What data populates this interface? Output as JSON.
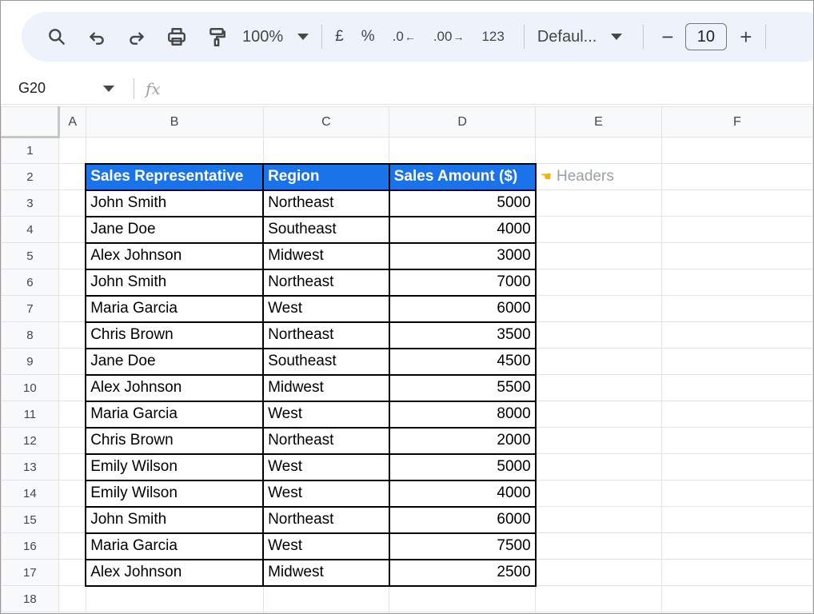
{
  "toolbar": {
    "zoom": "100%",
    "currency": "£",
    "percent": "%",
    "decrease_decimal": ".0",
    "increase_decimal": ".00",
    "number_format": "123",
    "font": "Defaul...",
    "font_size": "10",
    "minus": "−",
    "plus": "+"
  },
  "formula_bar": {
    "name_box": "G20",
    "fx": "fx",
    "formula": ""
  },
  "columns": [
    "A",
    "B",
    "C",
    "D",
    "E",
    "F"
  ],
  "rows": [
    "1",
    "2",
    "3",
    "4",
    "5",
    "6",
    "7",
    "8",
    "9",
    "10",
    "11",
    "12",
    "13",
    "14",
    "15",
    "16",
    "17",
    "18"
  ],
  "table": {
    "headers": [
      "Sales Representative",
      "Region",
      "Sales Amount ($)"
    ],
    "rows": [
      [
        "John Smith",
        "Northeast",
        "5000"
      ],
      [
        "Jane Doe",
        "Southeast",
        "4000"
      ],
      [
        "Alex Johnson",
        "Midwest",
        "3000"
      ],
      [
        "John Smith",
        "Northeast",
        "7000"
      ],
      [
        "Maria Garcia",
        "West",
        "6000"
      ],
      [
        "Chris Brown",
        "Northeast",
        "3500"
      ],
      [
        "Jane Doe",
        "Southeast",
        "4500"
      ],
      [
        "Alex Johnson",
        "Midwest",
        "5500"
      ],
      [
        "Maria Garcia",
        "West",
        "8000"
      ],
      [
        "Chris Brown",
        "Northeast",
        "2000"
      ],
      [
        "Emily Wilson",
        "West",
        "5000"
      ],
      [
        "Emily Wilson",
        "West",
        "4000"
      ],
      [
        "John Smith",
        "Northeast",
        "6000"
      ],
      [
        "Maria Garcia",
        "West",
        "7500"
      ],
      [
        "Alex Johnson",
        "Midwest",
        "2500"
      ]
    ]
  },
  "annotation": {
    "text": "Headers",
    "icon": "pointing-hand-icon"
  },
  "colors": {
    "header_bg": "#1a73e8",
    "header_text": "#ffffff",
    "toolbar_bg": "#eef2fa"
  }
}
